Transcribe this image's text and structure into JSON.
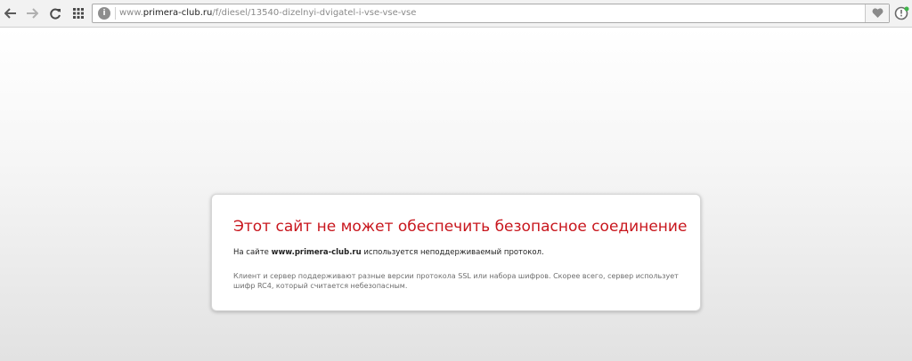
{
  "toolbar": {
    "back_icon": "back-arrow-icon",
    "forward_icon": "forward-arrow-icon",
    "reload_icon": "reload-icon",
    "speeddial_icon": "speed-dial-grid-icon",
    "address": {
      "site_info_icon": "site-info-icon",
      "url_prefix": "www.",
      "url_domain": "primera-club.ru",
      "url_path": "/f/diesel/13540-dizelnyi-dvigatel-i-vse-vse-vse",
      "bookmark_icon": "heart-icon"
    },
    "extension_icon": "extension-icon"
  },
  "error": {
    "title": "Этот сайт не может обеспечить безопасное соединение",
    "line_prefix": "На сайте ",
    "line_site": "www.primera-club.ru",
    "line_suffix": " используется неподдерживаемый протокол.",
    "detail": "Клиент и сервер поддерживают разные версии протокола SSL или набора шифров. Скорее всего, сервер использует шифр RC4, который считается небезопасным."
  },
  "colors": {
    "error_title": "#c8161d",
    "toolbar_bg": "#f2f2f2",
    "extension_dot": "#3fb54a"
  }
}
